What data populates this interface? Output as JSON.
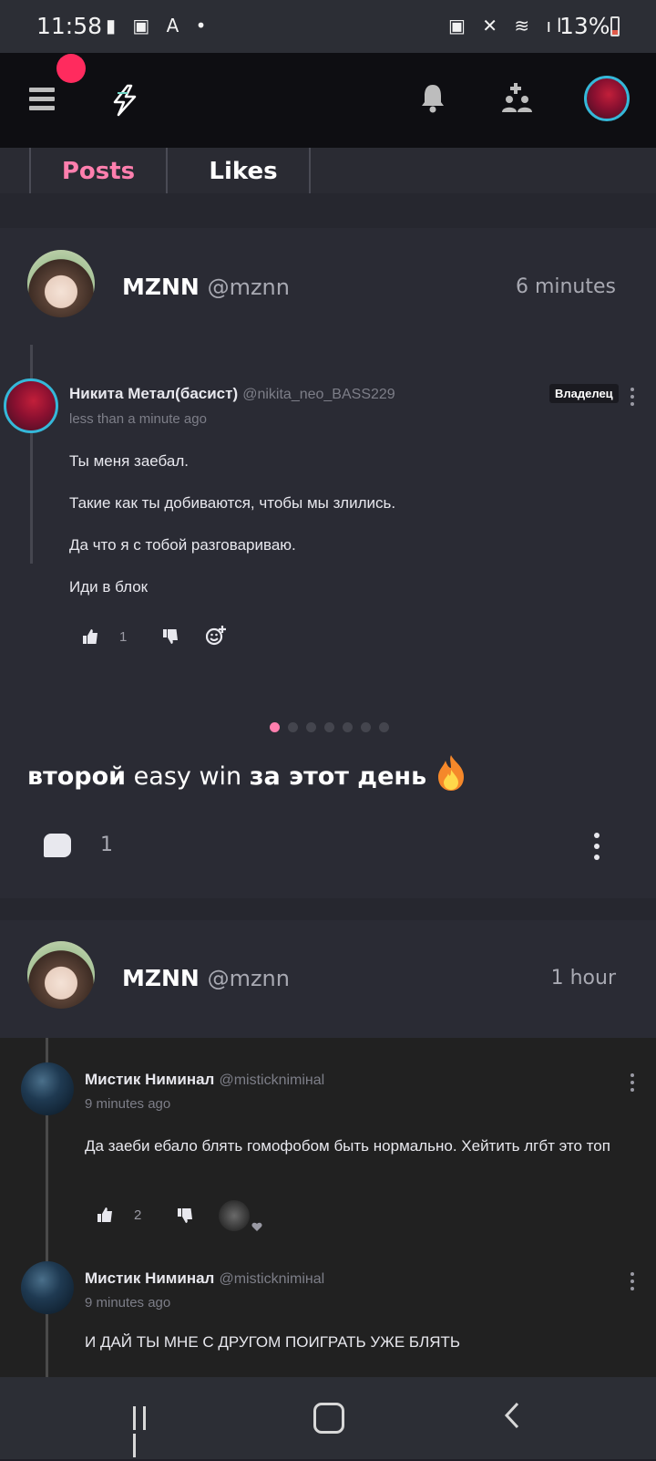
{
  "status_bar": {
    "time": "11:58",
    "left_icons": [
      "notification-icon",
      "image-icon",
      "translate-icon",
      "dot-icon"
    ],
    "right_icons": [
      "battery-saver-icon",
      "mute-icon",
      "wifi-icon",
      "signal-icon"
    ],
    "battery": "13%",
    "battery_level": 0.13
  },
  "app_bar": {
    "icons": [
      "menu-icon",
      "logo-icon",
      "bell-icon",
      "add-friend-icon",
      "profile-avatar"
    ],
    "accent": "#ff2b5e"
  },
  "tabs": [
    {
      "label": "Posts",
      "active": true
    },
    {
      "label": "Likes",
      "active": false
    }
  ],
  "posts": [
    {
      "author": "MZNN",
      "handle": "@mznn",
      "time": "6 minutes",
      "embedded_comment": {
        "name": "Никита Метал(басист)",
        "handle": "@nikita_neo_BASS229",
        "badge": "Владелец",
        "time": "less than a minute ago",
        "lines": [
          "Ты меня заебал.",
          "Такие как ты добиваются, чтобы мы злились.",
          "Да что я с тобой разговариваю.",
          "Иди в блок"
        ],
        "likes": "1"
      },
      "carousel_total": 7,
      "carousel_active": 1,
      "caption_bold_1": "второй",
      "caption_plain": " easy win ",
      "caption_bold_2": "за этот день",
      "comment_count": "1"
    },
    {
      "author": "MZNN",
      "handle": "@mznn",
      "time": "1 hour",
      "comments": [
        {
          "name": "Мистик Ниминал",
          "handle": "@misticknimінal",
          "time": "9 minutes ago",
          "text": "Да заеби ебало блять гомофобом быть нормально. Хейтить лгбт это топ",
          "likes": "2"
        },
        {
          "name": "Мистик Ниминал",
          "handle": "@misticknimінal",
          "time": "9 minutes ago",
          "text": "И ДАЙ ТЫ МНЕ С ДРУГОМ ПОИГРАТЬ УЖЕ БЛЯТЬ"
        }
      ]
    }
  ],
  "nav_bar": {
    "icons": [
      "recents-icon",
      "home-icon",
      "back-icon"
    ]
  },
  "colors": {
    "accent_pink": "#ff7fae",
    "notif_red": "#ff2b5e",
    "avatar_ring": "#35b8d9"
  }
}
